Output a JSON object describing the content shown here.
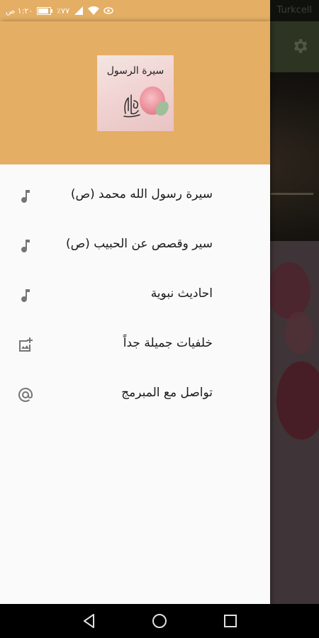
{
  "status_bar": {
    "time": "١:٢٠ ص",
    "battery": "٪٧٧",
    "carrier": "Turkcell"
  },
  "drawer": {
    "header": {
      "image_title": "سيرة الرسول"
    },
    "items": [
      {
        "label": "سيرة رسول الله محمد (ص)",
        "icon": "music-note-icon"
      },
      {
        "label": "سير وقصص عن الحبيب (ص)",
        "icon": "music-note-icon"
      },
      {
        "label": "احاديث نبوية",
        "icon": "music-note-icon"
      },
      {
        "label": "خلفيات  جميلة جداً",
        "icon": "add-photo-icon"
      },
      {
        "label": "تواصل مع المبرمج",
        "icon": "at-sign-icon"
      }
    ]
  },
  "colors": {
    "header_bg": "#e4ae64",
    "drawer_bg": "#fafafa",
    "icon_color": "#757575",
    "text_color": "#1a1a1a",
    "toolbar_bg": "#4f5b3c"
  },
  "nav_bar": {
    "icons": [
      "back-triangle-icon",
      "home-circle-icon",
      "recents-square-icon"
    ]
  }
}
